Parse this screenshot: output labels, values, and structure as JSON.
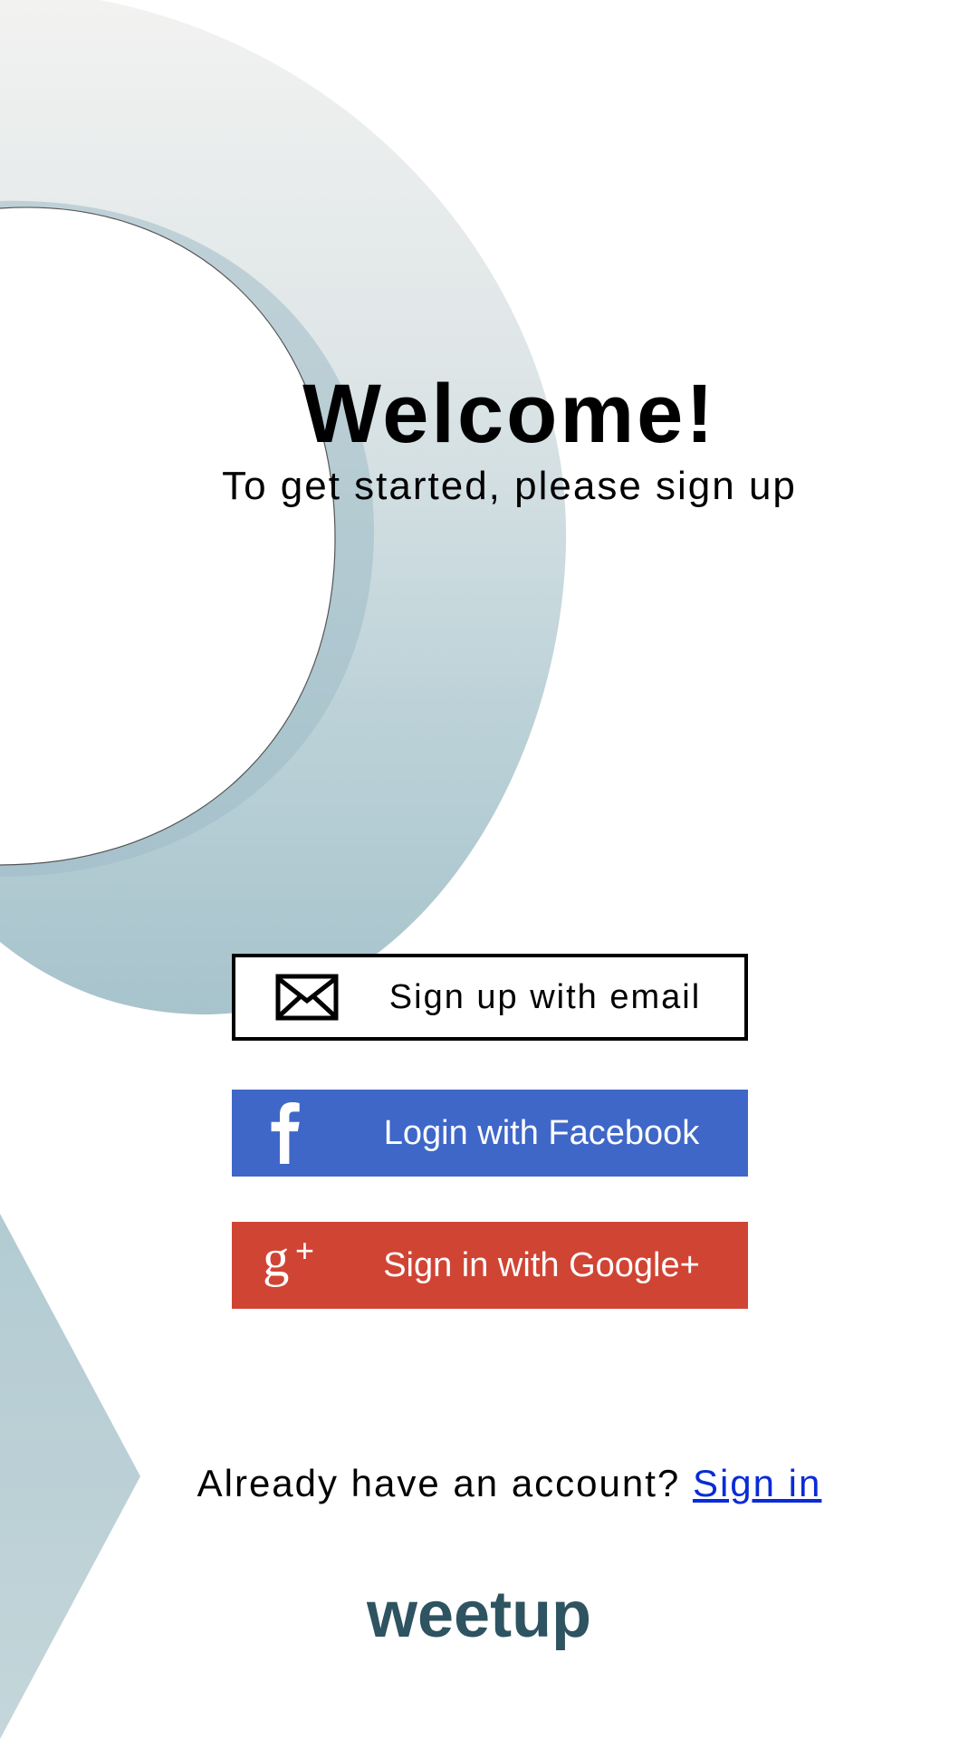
{
  "welcome": {
    "title": "Welcome!",
    "subtitle": "To get started, please sign up"
  },
  "buttons": {
    "email": {
      "label": "Sign up with email",
      "icon": "envelope-icon"
    },
    "facebook": {
      "label": "Login with Facebook",
      "icon": "facebook-icon",
      "color": "#3f67c8"
    },
    "google": {
      "label": "Sign in with Google+",
      "icon": "google-plus-icon",
      "color": "#d04434"
    }
  },
  "footer": {
    "prompt": "Already have an account? ",
    "link": "Sign in"
  },
  "brand": {
    "logo_text": "weetup",
    "color": "#2e5361"
  },
  "colors": {
    "decor_light": "#f0f0f0",
    "decor_blue": "#a9c5cd"
  }
}
